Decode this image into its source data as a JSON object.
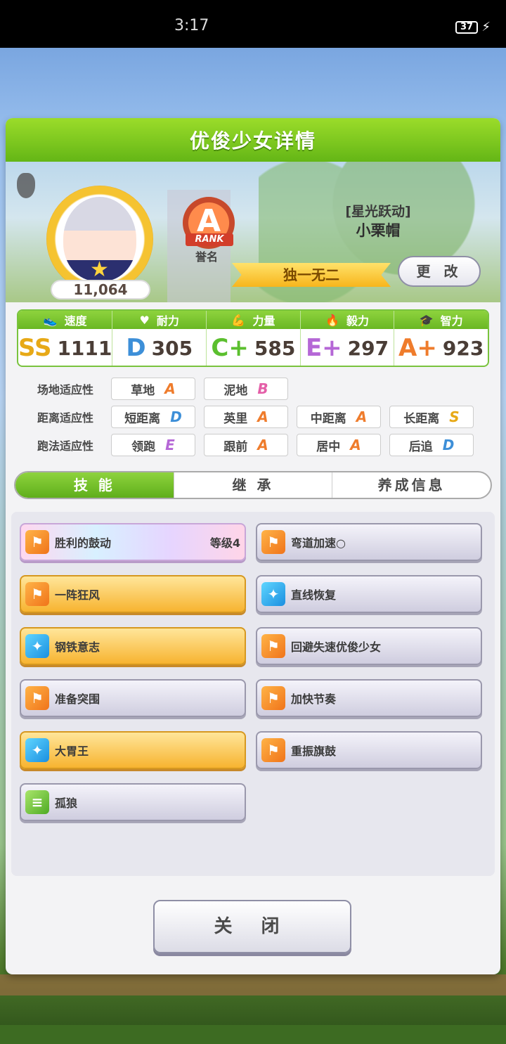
{
  "status_bar": {
    "time": "3:17",
    "battery": "37"
  },
  "dialog": {
    "title": "优俊少女详情",
    "fans": "11,064",
    "rank": {
      "grade": "A",
      "ribbon": "RANK",
      "label": "誉名"
    },
    "character": {
      "title": "[星光跃动]",
      "name": "小栗帽"
    },
    "epithet": "独一无二",
    "change_button": "更 改"
  },
  "stats": [
    {
      "icon": "shoe-icon",
      "label": "速度",
      "grade": "SS",
      "value": "1111",
      "color": "#e7a917"
    },
    {
      "icon": "heart-icon",
      "label": "耐力",
      "grade": "D",
      "value": "305",
      "color": "#3d8fd8"
    },
    {
      "icon": "arm-icon",
      "label": "力量",
      "grade": "C+",
      "value": "585",
      "color": "#5bbf2e"
    },
    {
      "icon": "flame-icon",
      "label": "毅力",
      "grade": "E+",
      "value": "297",
      "color": "#b567d6"
    },
    {
      "icon": "graduation-cap-icon",
      "label": "智力",
      "grade": "A+",
      "value": "923",
      "color": "#ef7c2c"
    }
  ],
  "aptitude": {
    "track": {
      "label": "场地适应性",
      "items": [
        {
          "name": "草地",
          "grade": "A"
        },
        {
          "name": "泥地",
          "grade": "B"
        }
      ]
    },
    "distance": {
      "label": "距离适应性",
      "items": [
        {
          "name": "短距离",
          "grade": "D"
        },
        {
          "name": "英里",
          "grade": "A"
        },
        {
          "name": "中距离",
          "grade": "A"
        },
        {
          "name": "长距离",
          "grade": "S"
        }
      ]
    },
    "style": {
      "label": "跑法适应性",
      "items": [
        {
          "name": "领跑",
          "grade": "E"
        },
        {
          "name": "跟前",
          "grade": "A"
        },
        {
          "name": "居中",
          "grade": "A"
        },
        {
          "name": "后追",
          "grade": "D"
        }
      ]
    }
  },
  "tabs": [
    {
      "label": "技 能",
      "active": true
    },
    {
      "label": "继 承",
      "active": false
    },
    {
      "label": "养成信息",
      "active": false
    }
  ],
  "skills": [
    {
      "name": "胜利的鼓动",
      "level": "等级4",
      "type": "speed",
      "style": "rainbow"
    },
    {
      "name": "弯道加速○",
      "level": "",
      "type": "speed",
      "style": "normal"
    },
    {
      "name": "一阵狂风",
      "level": "",
      "type": "speed",
      "style": "gold"
    },
    {
      "name": "直线恢复",
      "level": "",
      "type": "recover",
      "style": "normal"
    },
    {
      "name": "钢铁意志",
      "level": "",
      "type": "recover",
      "style": "gold"
    },
    {
      "name": "回避失速优俊少女",
      "level": "",
      "type": "speed",
      "style": "normal"
    },
    {
      "name": "准备突围",
      "level": "",
      "type": "speed",
      "style": "normal"
    },
    {
      "name": "加快节奏",
      "level": "",
      "type": "speed",
      "style": "normal"
    },
    {
      "name": "大胃王",
      "level": "",
      "type": "recover",
      "style": "gold"
    },
    {
      "name": "重振旗鼓",
      "level": "",
      "type": "speed",
      "style": "normal"
    },
    {
      "name": "孤狼",
      "level": "",
      "type": "debuff",
      "style": "normal"
    }
  ],
  "close_button": "关 闭",
  "grade_colors": {
    "S": "#e7a917",
    "A": "#ef7c2c",
    "B": "#e45fa8",
    "C": "#5bbf2e",
    "D": "#3d8fd8",
    "E": "#b567d6"
  }
}
